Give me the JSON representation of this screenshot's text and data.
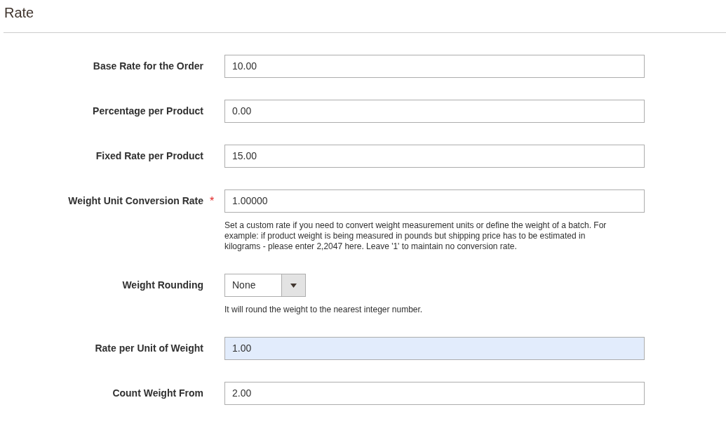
{
  "section": {
    "title": "Rate"
  },
  "fields": [
    {
      "kind": "text",
      "label": "Base Rate for the Order",
      "value": "10.00",
      "highlighted": false
    },
    {
      "kind": "text",
      "label": "Percentage per Product",
      "value": "0.00",
      "highlighted": false
    },
    {
      "kind": "text",
      "label": "Fixed Rate per Product",
      "value": "15.00",
      "highlighted": false
    },
    {
      "kind": "text",
      "label": "Weight Unit Conversion Rate",
      "value": "1.00000",
      "required_mark": "*",
      "highlighted": false,
      "note": "Set a custom rate if you need to convert weight measurement units or define the weight of a batch. For example: if product weight is being measured in pounds but shipping price has to be estimated in kilograms - please enter 2,2047 here. Leave '1' to maintain no conversion rate."
    },
    {
      "kind": "select",
      "label": "Weight Rounding",
      "value": "None",
      "highlighted": false,
      "note": "It will round the weight to the nearest integer number."
    },
    {
      "kind": "text",
      "label": "Rate per Unit of Weight",
      "value": "1.00",
      "highlighted": true
    },
    {
      "kind": "text",
      "label": "Count Weight From",
      "value": "2.00",
      "highlighted": false
    }
  ]
}
